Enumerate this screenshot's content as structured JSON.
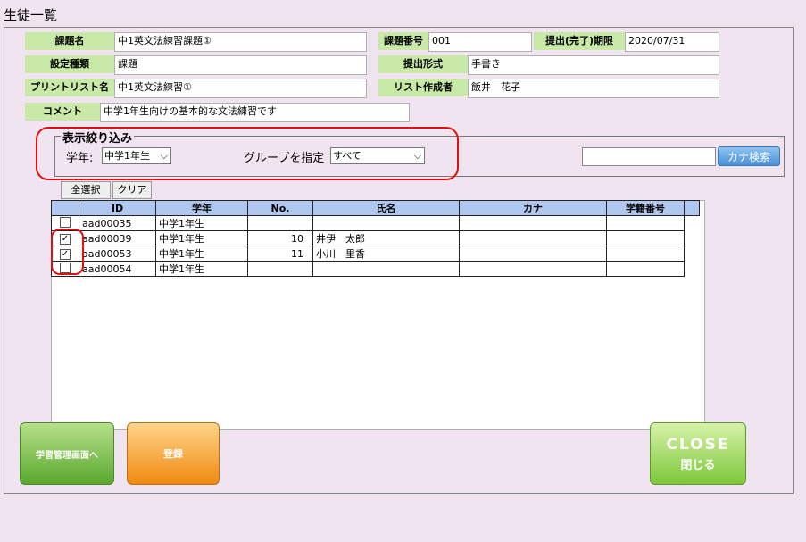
{
  "page": {
    "title": "生徒一覧"
  },
  "info": {
    "kadai_name_label": "課題名",
    "kadai_name_value": "中1英文法練習課題①",
    "kadai_no_label": "課題番号",
    "kadai_no_value": "001",
    "deadline_label": "提出(完了)期限",
    "deadline_value": "2020/07/31",
    "setting_type_label": "設定種類",
    "setting_type_value": "課題",
    "submit_format_label": "提出形式",
    "submit_format_value": "手書き",
    "printlist_label": "プリントリスト名",
    "printlist_value": "中1英文法練習①",
    "list_author_label": "リスト作成者",
    "list_author_value": "飯井　花子",
    "comment_label": "コメント",
    "comment_value": "中学1年生向けの基本的な文法練習です"
  },
  "filter": {
    "legend": "表示絞り込み",
    "grade_label": "学年:",
    "grade_value": "中学1年生",
    "group_label": "グループを指定",
    "group_value": "すべて",
    "kana_search_placeholder": "",
    "kana_search_button": "カナ検索"
  },
  "actions": {
    "select_all": "全選択",
    "clear": "クリア"
  },
  "table": {
    "headers": [
      "ID",
      "学年",
      "No.",
      "氏名",
      "カナ",
      "学籍番号"
    ],
    "rows": [
      {
        "checked": false,
        "id": "aad00035",
        "grade": "中学1年生",
        "no": "",
        "name": "",
        "kana": "",
        "student_no": ""
      },
      {
        "checked": true,
        "id": "aad00039",
        "grade": "中学1年生",
        "no": "10",
        "name": "井伊　太郎",
        "kana": "",
        "student_no": ""
      },
      {
        "checked": true,
        "id": "aad00053",
        "grade": "中学1年生",
        "no": "11",
        "name": "小川　里香",
        "kana": "",
        "student_no": ""
      },
      {
        "checked": false,
        "id": "aad00054",
        "grade": "中学1年生",
        "no": "",
        "name": "",
        "kana": "",
        "student_no": ""
      }
    ]
  },
  "buttons": {
    "manage": "学習管理画面へ",
    "register": "登録",
    "close_en": "CLOSE",
    "close_jp": "閉じる"
  },
  "colors": {
    "label_green": "#c8e9a8",
    "header_blue": "#b0c8f0",
    "highlight_red": "#e01010",
    "background": "#f0e4f0"
  }
}
